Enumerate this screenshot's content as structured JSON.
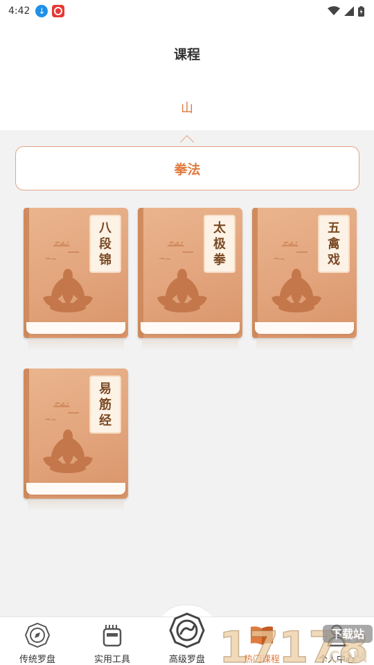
{
  "status_bar": {
    "time": "4:42"
  },
  "header": {
    "title": "课程",
    "tab": "山"
  },
  "category": {
    "label": "拳法"
  },
  "books": [
    {
      "title": "八段锦",
      "chars": [
        "八",
        "段",
        "锦"
      ]
    },
    {
      "title": "太极拳",
      "chars": [
        "太",
        "极",
        "拳"
      ]
    },
    {
      "title": "五禽戏",
      "chars": [
        "五",
        "禽",
        "戏"
      ]
    },
    {
      "title": "易筋经",
      "chars": [
        "易",
        "筋",
        "经"
      ]
    }
  ],
  "tabbar": {
    "items": [
      {
        "label": "传统罗盘",
        "icon": "compass-icon"
      },
      {
        "label": "实用工具",
        "icon": "toolbox-icon"
      },
      {
        "label": "高级罗盘",
        "icon": "taiji-icon"
      },
      {
        "label": "热门课程",
        "icon": "book-open-icon",
        "active": true
      },
      {
        "label": "个人中心",
        "icon": "user-icon"
      }
    ]
  },
  "watermark": {
    "text": "17178",
    "sub": ".COM",
    "badge": "下载站"
  },
  "colors": {
    "accent": "#e07a3e",
    "book_cover": "#e2a47c",
    "lotus": "#c4774a"
  }
}
